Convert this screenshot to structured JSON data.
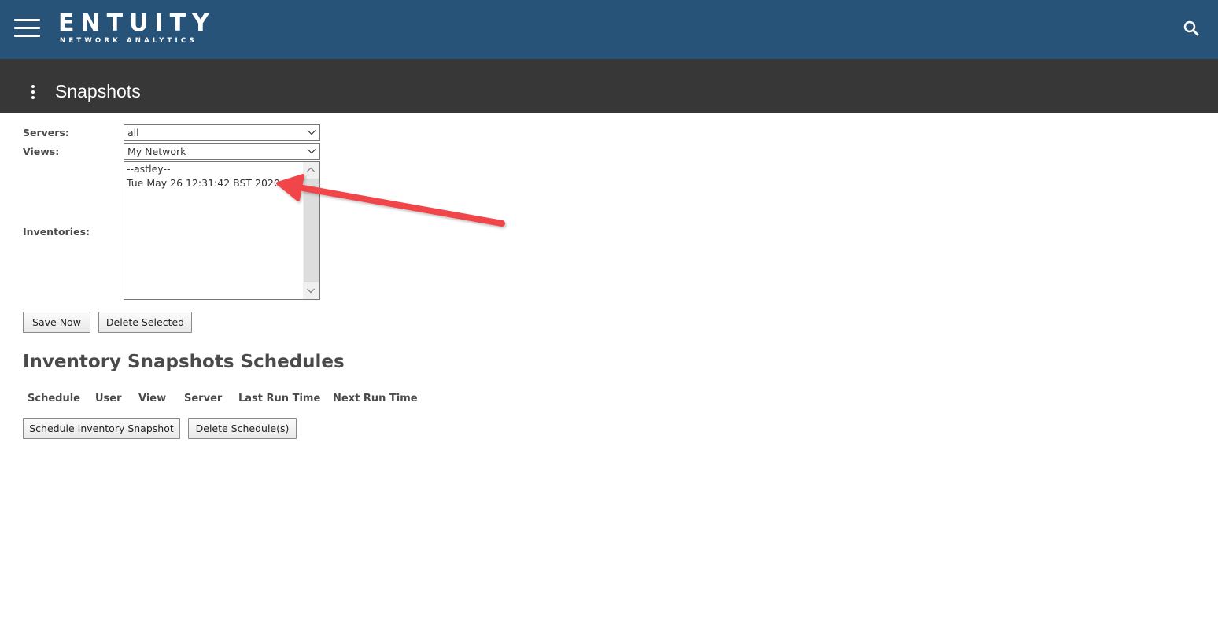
{
  "brand": {
    "name": "ENTUITY",
    "tagline": "NETWORK ANALYTICS"
  },
  "header": {
    "menu_icon": "hamburger-menu-icon",
    "search_icon": "search-icon",
    "background_color": "#285379"
  },
  "titlebar": {
    "title": "Snapshots",
    "menu_icon": "vertical-dots-icon",
    "background_color": "#373737"
  },
  "form": {
    "servers": {
      "label": "Servers:",
      "value": "all"
    },
    "views": {
      "label": "Views:",
      "value": "My Network"
    },
    "inventories": {
      "label": "Inventories:",
      "options": [
        "--astley--",
        "Tue May 26 12:31:42 BST 2020"
      ]
    },
    "buttons": {
      "save_now": "Save Now",
      "delete_selected": "Delete Selected"
    }
  },
  "schedules": {
    "title": "Inventory Snapshots Schedules",
    "columns": [
      "Schedule",
      "User",
      "View",
      "Server",
      "Last Run Time",
      "Next Run Time"
    ],
    "rows": [],
    "buttons": {
      "schedule_snapshot": "Schedule Inventory Snapshot",
      "delete_schedules": "Delete Schedule(s)"
    }
  },
  "annotation": {
    "arrow_color": "#f0454a"
  }
}
